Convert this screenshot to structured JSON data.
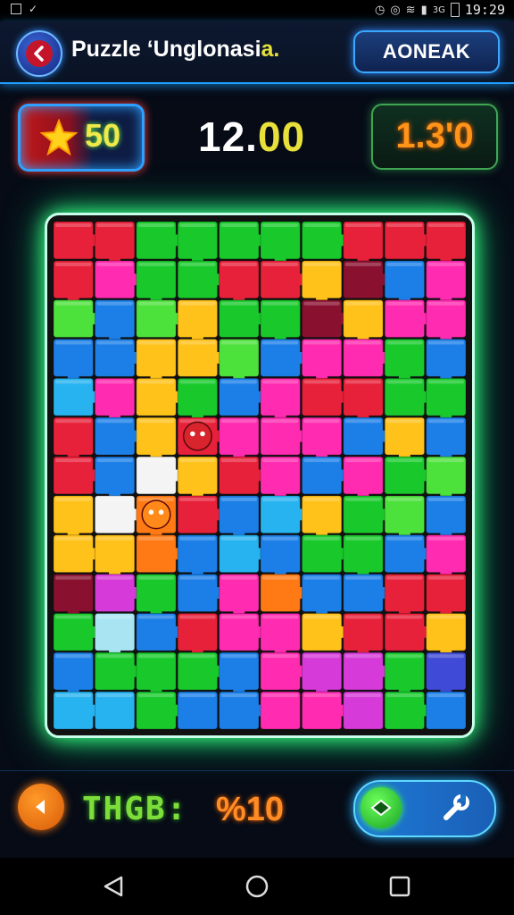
{
  "status_bar": {
    "time": "19:29",
    "network_label": "3G",
    "icons": [
      "image-icon",
      "notification-icon",
      "alarm-icon",
      "vibrate-icon",
      "wifi-icon",
      "signal-icon",
      "battery-icon"
    ]
  },
  "header": {
    "back_icon": "back-arrow-icon",
    "title_main": "Puzzle ‘Unglonasi",
    "title_accent": "a.",
    "button_label": "AONEAK"
  },
  "stats": {
    "score_icon": "star-icon",
    "score": "50",
    "timer_main": "12.",
    "timer_decimal": "00",
    "moves": "1.3'0"
  },
  "board": {
    "rows": 12,
    "cols": 10,
    "palette": {
      "R": "#e8213a",
      "G": "#19c92c",
      "L": "#4de13c",
      "B": "#1c7fe8",
      "C": "#27b3f0",
      "P": "#ff2bb0",
      "M": "#d63ad8",
      "Y": "#ffc21a",
      "O": "#ff7a14",
      "W": "#f4f4f4",
      "S": "#a8e4f2",
      "D": "#8a1030",
      "V": "#3f4ad6"
    },
    "grid": [
      "RRGGGGGRRR",
      "RPGGRRYDBP",
      "LBLYGGDYPP",
      "BBYYLBPPGB",
      "CPYGBPRRGG",
      "RBYRPPPBYB",
      "RBWYRPBPGL",
      "YWORBCYGLB",
      "YYOBCBGGBP",
      "DMGBPOBBRR",
      "GSBRPPYRRY",
      "BGGGBPMMGV",
      "CCGBBPPMGB"
    ]
  },
  "footer": {
    "prev_icon": "arrow-left-icon",
    "label": "THGB:",
    "value": "%10",
    "toggle_left_icon": "hint-icon",
    "toggle_right_icon": "wrench-icon"
  },
  "nav": {
    "back_icon": "nav-back-icon",
    "home_icon": "nav-home-icon",
    "recents_icon": "nav-recents-icon"
  }
}
